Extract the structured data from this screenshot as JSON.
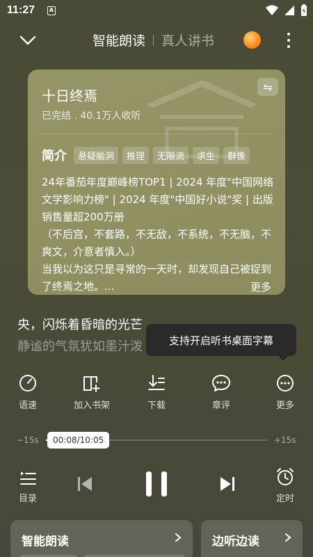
{
  "status_bar": {
    "time": "11:27",
    "a_badge": "A"
  },
  "nav": {
    "tab_active": "智能朗读",
    "tab_inactive": "真人讲书"
  },
  "book": {
    "title": "十日终焉",
    "meta": "已完结 . 40.1万人收听",
    "intro_label": "简介",
    "tags": [
      "悬疑脑洞",
      "推理",
      "无限流",
      "求生",
      "群像"
    ],
    "synopsis": [
      "24年番茄年度巅峰榜TOP1 | 2024 年度\"中国网络文学影响力榜\" | 2024 年度\"中国好小说\"奖 | 出版销售量超200万册",
      "（不后宫，不套路，不无敌，不系统，不无脑，不爽文，介意者慎入。）",
      "当我以为这只是寻常的一天时，却发现自己被捉到了终焉之地。..."
    ],
    "more_label": "更多"
  },
  "lyrics": {
    "current": "央，闪烁着昏暗的光芒",
    "next": "静谧的气氛犹如墨汁泼"
  },
  "tooltip": "支持开启听书桌面字幕",
  "actions": [
    {
      "label": "语速",
      "icon": "speed-icon"
    },
    {
      "label": "加入书架",
      "icon": "bookshelf-add-icon"
    },
    {
      "label": "下载",
      "icon": "download-icon"
    },
    {
      "label": "章评",
      "icon": "comment-icon"
    },
    {
      "label": "更多",
      "icon": "more-icon"
    }
  ],
  "progress": {
    "skip_back": "−15s",
    "skip_forward": "+15s",
    "time": "00:08/10:05",
    "fraction": 0.013
  },
  "controls": {
    "playlist_label": "目录",
    "timer_label": "定时"
  },
  "bottom_cards": {
    "left": "智能朗读",
    "right": "边听边读"
  },
  "colors": {
    "background": "#4a4a36",
    "card": "#9c9c6a",
    "tooltip": "#2a2a2a",
    "orb": "#ff9a2c"
  }
}
